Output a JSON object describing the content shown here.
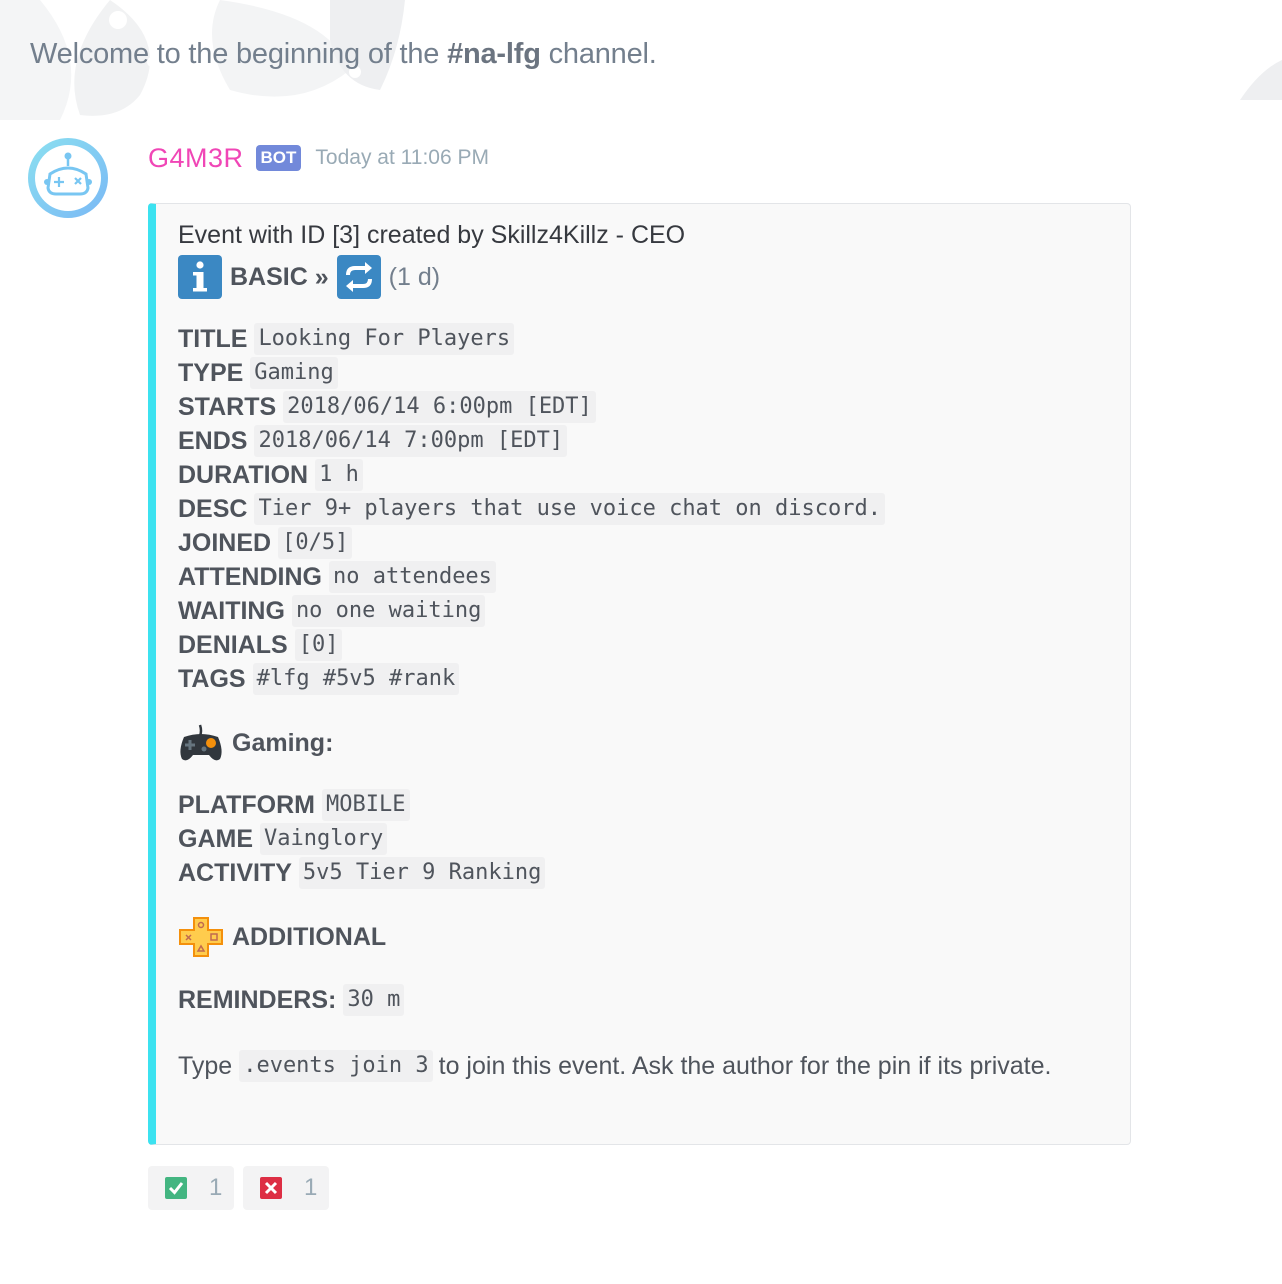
{
  "welcome": {
    "prefix": "Welcome to the beginning of the ",
    "channel": "#na-lfg",
    "suffix": " channel."
  },
  "message": {
    "username": "G4M3R",
    "bot_tag": "BOT",
    "timestamp": "Today at 11:06 PM",
    "avatar_icon": "robot-gamepad-icon"
  },
  "embed": {
    "accent_color": "#3ce2f0",
    "author": "Event with ID [3] created by Skillz4Killz - CEO",
    "basic": {
      "info_icon": "information-icon",
      "label": "BASIC »",
      "repeat_icon": "repeat-icon",
      "duration_note": "(1 d)"
    },
    "fields": [
      {
        "key": "TITLE",
        "value": "Looking For Players"
      },
      {
        "key": "TYPE",
        "value": "Gaming"
      },
      {
        "key": "STARTS",
        "value": "2018/06/14 6:00pm [EDT]"
      },
      {
        "key": "ENDS",
        "value": "2018/06/14 7:00pm [EDT]"
      },
      {
        "key": "DURATION",
        "value": "1 h"
      },
      {
        "key": "DESC",
        "value": "Tier 9+ players that use voice chat on discord."
      },
      {
        "key": "JOINED",
        "value": "[0/5]"
      },
      {
        "key": "ATTENDING",
        "value": "no attendees"
      },
      {
        "key": "WAITING",
        "value": "no one waiting"
      },
      {
        "key": "DENIALS",
        "value": "[0]"
      },
      {
        "key": "TAGS",
        "value": "#lfg #5v5 #rank"
      }
    ],
    "gaming": {
      "icon": "video-game-controller-icon",
      "title": "Gaming:",
      "fields": [
        {
          "key": "PLATFORM",
          "value": "MOBILE"
        },
        {
          "key": "GAME",
          "value": "Vainglory"
        },
        {
          "key": "ACTIVITY",
          "value": "5v5 Tier 9 Ranking"
        }
      ]
    },
    "additional": {
      "icon": "playstation-plus-icon",
      "title": "ADDITIONAL",
      "reminders_key": "REMINDERS:",
      "reminders_value": "30 m"
    },
    "footer": {
      "prefix": "Type",
      "command": ".events join 3",
      "suffix": "to join this event. Ask the author for the pin if its private."
    }
  },
  "reactions": [
    {
      "icon": "check-mark-icon",
      "count": "1",
      "color": "#43b581"
    },
    {
      "icon": "cross-mark-icon",
      "count": "1",
      "color": "#f04747"
    }
  ]
}
